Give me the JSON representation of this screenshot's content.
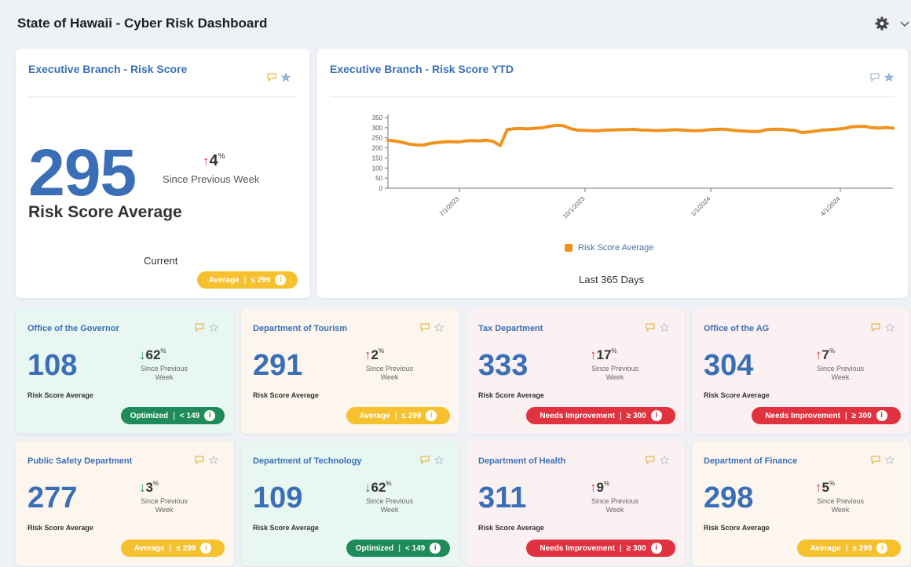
{
  "header": {
    "title": "State of Hawaii - Cyber Risk Dashboard",
    "settings_icon": "gear-icon",
    "menu_icon": "chevron-down-icon"
  },
  "exec_score": {
    "title": "Executive Branch - Risk Score",
    "value": "295",
    "change_arrow": "↑",
    "change_value": "4",
    "change_unit": "%",
    "since": "Since Previous Week",
    "label": "Risk Score Average",
    "current": "Current",
    "badge": {
      "status": "Average",
      "threshold": "≤ 299",
      "info": "i"
    }
  },
  "exec_ytd": {
    "title": "Executive Branch - Risk Score YTD",
    "legend": "Risk Score Average",
    "footer": "Last 365 Days"
  },
  "chart_data": {
    "type": "line",
    "series": [
      {
        "name": "Risk Score Average",
        "color": "#f0921e",
        "values": [
          238,
          234,
          228,
          219,
          215,
          214,
          222,
          226,
          230,
          231,
          229,
          234,
          236,
          235,
          238,
          232,
          211,
          290,
          295,
          296,
          294,
          297,
          300,
          307,
          312,
          310,
          296,
          288,
          287,
          286,
          285,
          288,
          289,
          290,
          291,
          292,
          289,
          288,
          286,
          287,
          288,
          290,
          288,
          286,
          285,
          287,
          291,
          292,
          293,
          288,
          285,
          283,
          281,
          282,
          291,
          292,
          293,
          289,
          287,
          276,
          279,
          283,
          289,
          290,
          293,
          296,
          304,
          306,
          307,
          300,
          298,
          301,
          298
        ]
      }
    ],
    "yticks": [
      "0",
      "50",
      "100",
      "150",
      "200",
      "250",
      "300",
      "350"
    ],
    "ylim": [
      0,
      350
    ],
    "xticks": [
      "7/1/2023",
      "10/1/2023",
      "1/1/2024",
      "4/1/2024"
    ],
    "grid": false,
    "legend_position": "bottom"
  },
  "colors": {
    "accent": "#3a6fb7",
    "good": "#1f8a5a",
    "average": "#f5c12e",
    "bad": "#e0323f",
    "line": "#f0921e"
  },
  "common": {
    "risk_label": "Risk Score Average",
    "since": "Since Previous Week",
    "info": "i",
    "sep": "|"
  },
  "departments": [
    {
      "name": "Office of the Governor",
      "value": "108",
      "direction": "down",
      "arrow": "↓",
      "change": "62",
      "unit": "%",
      "status": "Optimized",
      "threshold": "< 149",
      "tone": "green",
      "bg": "#e8f7f2"
    },
    {
      "name": "Department of Tourism",
      "value": "291",
      "direction": "up",
      "arrow": "↑",
      "change": "2",
      "unit": "%",
      "status": "Average",
      "threshold": "≤ 299",
      "tone": "yellow",
      "bg": "#fdf6ee"
    },
    {
      "name": "Tax Department",
      "value": "333",
      "direction": "up",
      "arrow": "↑",
      "change": "17",
      "unit": "%",
      "status": "Needs Improvement",
      "threshold": "≥ 300",
      "tone": "red",
      "bg": "#fcf1f2"
    },
    {
      "name": "Office of the AG",
      "value": "304",
      "direction": "up",
      "arrow": "↑",
      "change": "7",
      "unit": "%",
      "status": "Needs Improvement",
      "threshold": "≥ 300",
      "tone": "red",
      "bg": "#fcf1f2"
    },
    {
      "name": "Public Safety Department",
      "value": "277",
      "direction": "down",
      "arrow": "↓",
      "change": "3",
      "unit": "%",
      "status": "Average",
      "threshold": "≤ 299",
      "tone": "yellow",
      "bg": "#fdf6ee"
    },
    {
      "name": "Department of Technology",
      "value": "109",
      "direction": "down",
      "arrow": "↓",
      "change": "62",
      "unit": "%",
      "status": "Optimized",
      "threshold": "< 149",
      "tone": "green",
      "bg": "#e8f7f2"
    },
    {
      "name": "Department of Health",
      "value": "311",
      "direction": "up",
      "arrow": "↑",
      "change": "9",
      "unit": "%",
      "status": "Needs Improvement",
      "threshold": "≥ 300",
      "tone": "red",
      "bg": "#fcf1f2"
    },
    {
      "name": "Department of Finance",
      "value": "298",
      "direction": "up",
      "arrow": "↑",
      "change": "5",
      "unit": "%",
      "status": "Average",
      "threshold": "≤ 299",
      "tone": "yellow",
      "bg": "#fdf6ee"
    }
  ]
}
